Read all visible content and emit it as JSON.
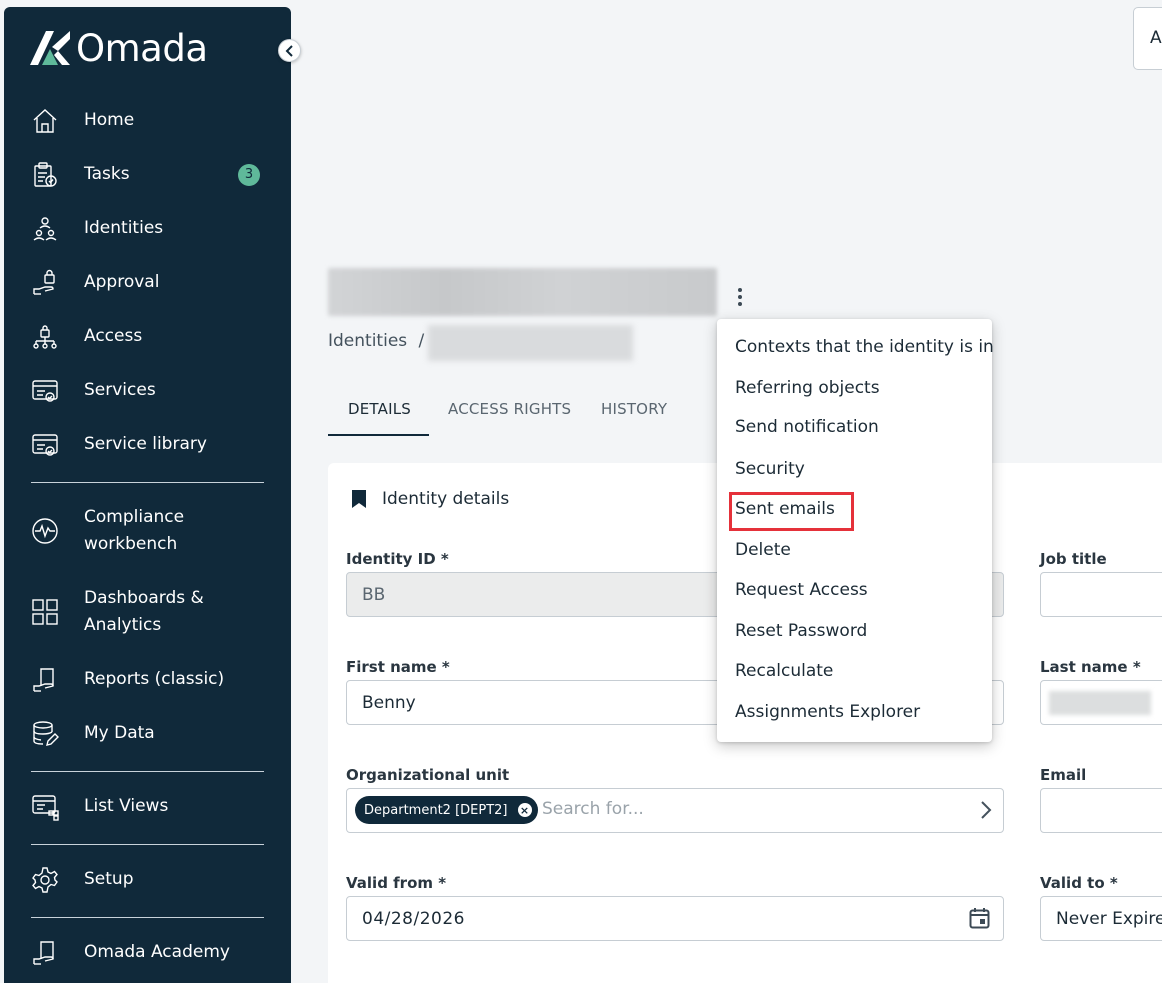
{
  "app": {
    "logo_text": "Omada"
  },
  "sidebar": {
    "items": [
      {
        "label": "Home",
        "icon": "home-icon"
      },
      {
        "label": "Tasks",
        "icon": "clipboard-icon",
        "badge": "3"
      },
      {
        "label": "Identities",
        "icon": "identities-icon"
      },
      {
        "label": "Approval",
        "icon": "approval-icon"
      },
      {
        "label": "Access",
        "icon": "access-icon"
      },
      {
        "label": "Services",
        "icon": "services-icon"
      },
      {
        "label": "Service library",
        "icon": "service-library-icon"
      },
      {
        "label_line1": "Compliance",
        "label_line2": "workbench",
        "icon": "pulse-icon"
      },
      {
        "label_line1": "Dashboards &",
        "label_line2": "Analytics",
        "icon": "grid-icon"
      },
      {
        "label": "Reports (classic)",
        "icon": "reports-icon"
      },
      {
        "label": "My Data",
        "icon": "database-icon"
      },
      {
        "label": "List Views",
        "icon": "list-views-icon"
      },
      {
        "label": "Setup",
        "icon": "gear-icon"
      },
      {
        "label": "Omada Academy",
        "icon": "academy-icon"
      }
    ]
  },
  "header": {
    "top_button_label": "A"
  },
  "breadcrumb": {
    "root": "Identities",
    "separator": "/"
  },
  "tabs": [
    {
      "label": "DETAILS",
      "active": true
    },
    {
      "label": "ACCESS RIGHTS",
      "active": false
    },
    {
      "label": "HISTORY",
      "active": false
    }
  ],
  "section": {
    "title": "Identity details"
  },
  "form": {
    "identity_id": {
      "label": "Identity ID *",
      "value": "BB"
    },
    "job_title": {
      "label": "Job title",
      "value": ""
    },
    "first_name": {
      "label": "First name *",
      "value": "Benny"
    },
    "last_name": {
      "label": "Last name *"
    },
    "org_unit": {
      "label": "Organizational unit",
      "chip": "Department2 [DEPT2]",
      "placeholder": "Search for..."
    },
    "email": {
      "label": "Email",
      "value": ""
    },
    "valid_from": {
      "label": "Valid from *",
      "value": "04/28/2026"
    },
    "valid_to": {
      "label": "Valid to *",
      "value": "Never Expires"
    }
  },
  "context_menu": {
    "items": [
      "Contexts that the identity is in",
      "Referring objects",
      "Send notification",
      "Security",
      "Sent emails",
      "Delete",
      "Request Access",
      "Reset Password",
      "Recalculate",
      "Assignments Explorer"
    ],
    "highlighted": "Sent emails"
  },
  "colors": {
    "sidebar_bg": "#10293a",
    "badge": "#5fb99a",
    "highlight": "#e5313a"
  }
}
